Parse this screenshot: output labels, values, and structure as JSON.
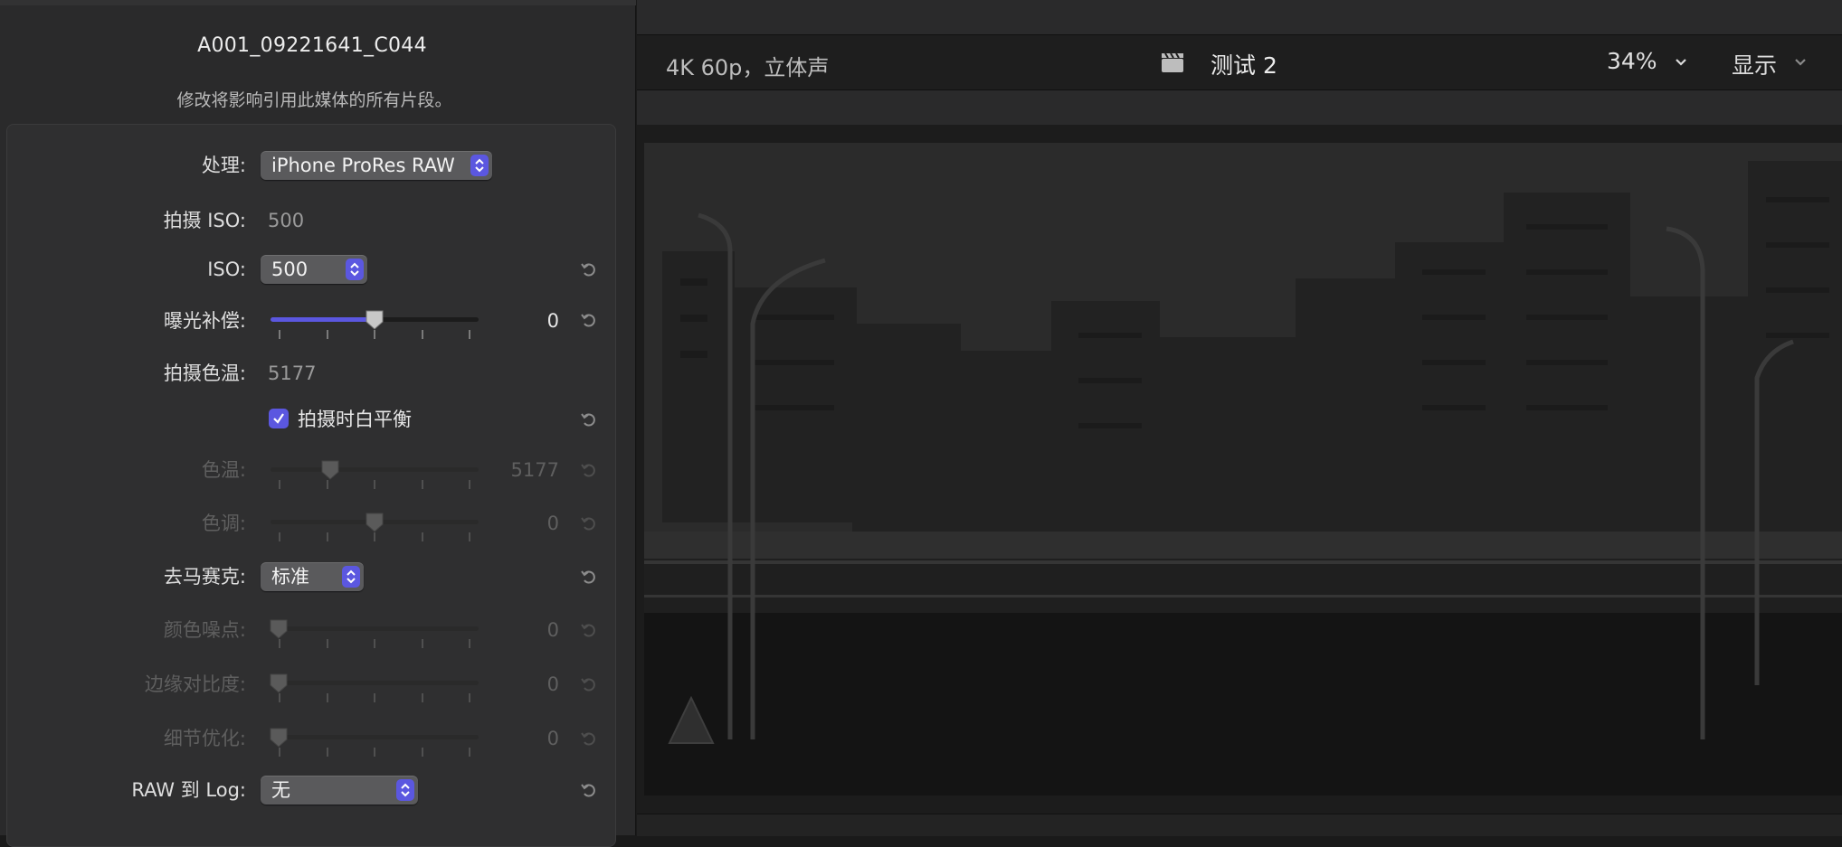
{
  "inspector": {
    "clip_name": "A001_09221641_C044",
    "note": "修改将影响引用此媒体的所有片段。",
    "rows": {
      "processing": {
        "label": "处理:",
        "value": "iPhone ProRes RAW"
      },
      "capture_iso": {
        "label": "拍摄 ISO:",
        "value": "500"
      },
      "iso": {
        "label": "ISO:",
        "value": "500"
      },
      "exposure": {
        "label": "曝光补偿:",
        "value": "0",
        "level": 0.5
      },
      "capture_temp": {
        "label": "拍摄色温:",
        "value": "5177"
      },
      "white_balance": {
        "label": "拍摄时白平衡",
        "checked": true
      },
      "temperature": {
        "label": "色温:",
        "value": "5177",
        "level": 0.27
      },
      "tint": {
        "label": "色调:",
        "value": "0",
        "level": 0.5
      },
      "demosaic": {
        "label": "去马赛克:",
        "value": "标准"
      },
      "color_noise": {
        "label": "颜色噪点:",
        "value": "0",
        "level": 0
      },
      "edge_contrast": {
        "label": "边缘对比度:",
        "value": "0",
        "level": 0
      },
      "detail": {
        "label": "细节优化:",
        "value": "0",
        "level": 0
      },
      "raw_to_log": {
        "label": "RAW 到 Log:",
        "value": "无"
      }
    }
  },
  "viewer": {
    "format": "4K 60p，立体声",
    "project": "测试 2",
    "zoom": "34%",
    "view_menu": "显示"
  },
  "colors": {
    "accent": "#5b57e0",
    "panel": "#2a2a2b"
  },
  "icons": [
    "reset-icon",
    "clapperboard-icon",
    "chevron-down-icon",
    "checkmark-icon",
    "stepper-arrows-icon"
  ]
}
